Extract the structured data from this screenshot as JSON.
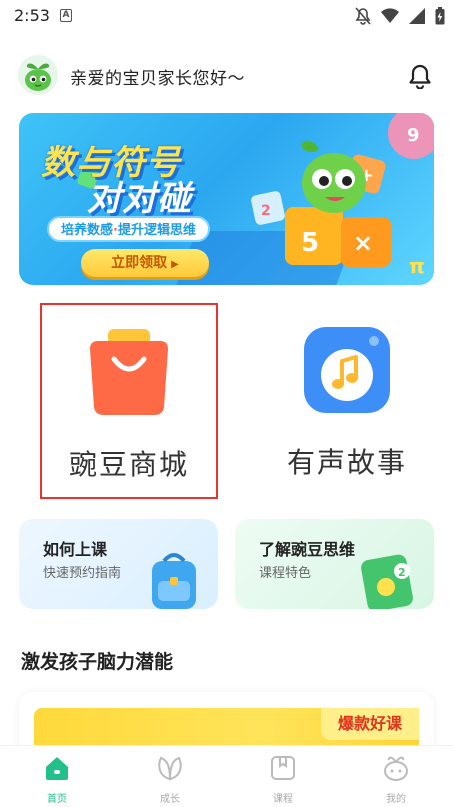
{
  "status_bar": {
    "time": "2:53",
    "notification_icon": "a-letter-icon",
    "icons": [
      "bell-off-icon",
      "wifi-icon",
      "signal-icon",
      "battery-charging-icon"
    ]
  },
  "header": {
    "greeting": "亲爱的宝贝家长您好～",
    "avatar_icon": "pea-mascot-icon",
    "notification_icon": "bell-icon"
  },
  "banner": {
    "title_line1": "数与符号",
    "title_line2": "对对碰",
    "tag_part1": "培养数感",
    "tag_sep": "·",
    "tag_part2": "提升逻辑思维",
    "button": "立即领取"
  },
  "features": [
    {
      "label": "豌豆商城",
      "icon": "shopping-bag-icon",
      "color": "#ff6a46"
    },
    {
      "label": "有声故事",
      "icon": "music-note-icon",
      "color": "#3d8ef7"
    }
  ],
  "cards": [
    {
      "title": "如何上课",
      "subtitle": "快速预约指南"
    },
    {
      "title": "了解豌豆思维",
      "subtitle": "课程特色"
    }
  ],
  "section": {
    "title": "激发孩子脑力潜能"
  },
  "promo": {
    "badge": "爆款好课"
  },
  "bottom_nav": [
    {
      "label": "首页",
      "icon": "home-icon",
      "active": true
    },
    {
      "label": "成长",
      "icon": "leaf-icon",
      "active": false
    },
    {
      "label": "课程",
      "icon": "book-icon",
      "active": false
    },
    {
      "label": "我的",
      "icon": "mascot-face-icon",
      "active": false
    }
  ],
  "colors": {
    "accent": "#22c08a",
    "highlight_border": "#e8332f",
    "banner_blue": "#2ba7f0"
  }
}
